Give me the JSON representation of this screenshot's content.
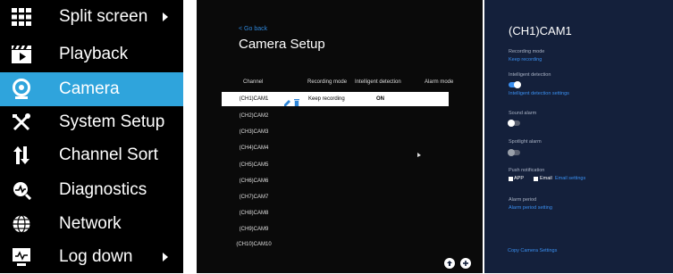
{
  "menu": {
    "items": [
      {
        "label": "Split screen",
        "icon": "grid-icon",
        "has_submenu": true
      },
      {
        "label": "Playback",
        "icon": "clapperboard-icon"
      },
      {
        "label": "Camera",
        "icon": "camera-icon",
        "active": true
      },
      {
        "label": "System Setup",
        "icon": "tools-icon"
      },
      {
        "label": "Channel Sort",
        "icon": "sort-icon"
      },
      {
        "label": "Diagnostics",
        "icon": "diagnostics-icon"
      },
      {
        "label": "Network",
        "icon": "globe-icon"
      },
      {
        "label": "Log down",
        "icon": "monitor-icon",
        "has_submenu": true
      }
    ],
    "active_color": "#2fa4dc"
  },
  "setup": {
    "go_back": "< Go back",
    "title": "Camera Setup",
    "columns": [
      "Channel",
      "Recording mode",
      "Intelligent detection",
      "Alarm mode"
    ],
    "channels": [
      "(CH1)CAM1",
      "(CH2)CAM2",
      "(CH3)CAM3",
      "(CH4)CAM4",
      "(CH5)CAM5",
      "(CH6)CAM6",
      "(CH7)CAM7",
      "(CH8)CAM8",
      "(CH9)CAM9",
      "(CH10)CAM10"
    ],
    "selected_row": {
      "recording_mode": "Keep recording",
      "intelligent_detection": "ON"
    }
  },
  "detail": {
    "title": "(CH1)CAM1",
    "recording_mode_label": "Recording mode",
    "recording_mode_value": "Keep recording",
    "intelligent_detection_label": "Intelligent detection",
    "intelligent_detection_on": true,
    "intelligent_detection_settings": "Intelligent detection settings",
    "sound_alarm_label": "Sound alarm",
    "sound_alarm_on": false,
    "spotlight_alarm_label": "Spotlight alarm",
    "spotlight_alarm_on": false,
    "push_notification_label": "Push notification",
    "app_label": "APP",
    "email_label": "Email",
    "email_settings": "Email settings",
    "alarm_period_label": "Alarm period",
    "alarm_period_setting": "Alarm period setting",
    "copy_camera_settings": "Copy Camera Settings"
  }
}
